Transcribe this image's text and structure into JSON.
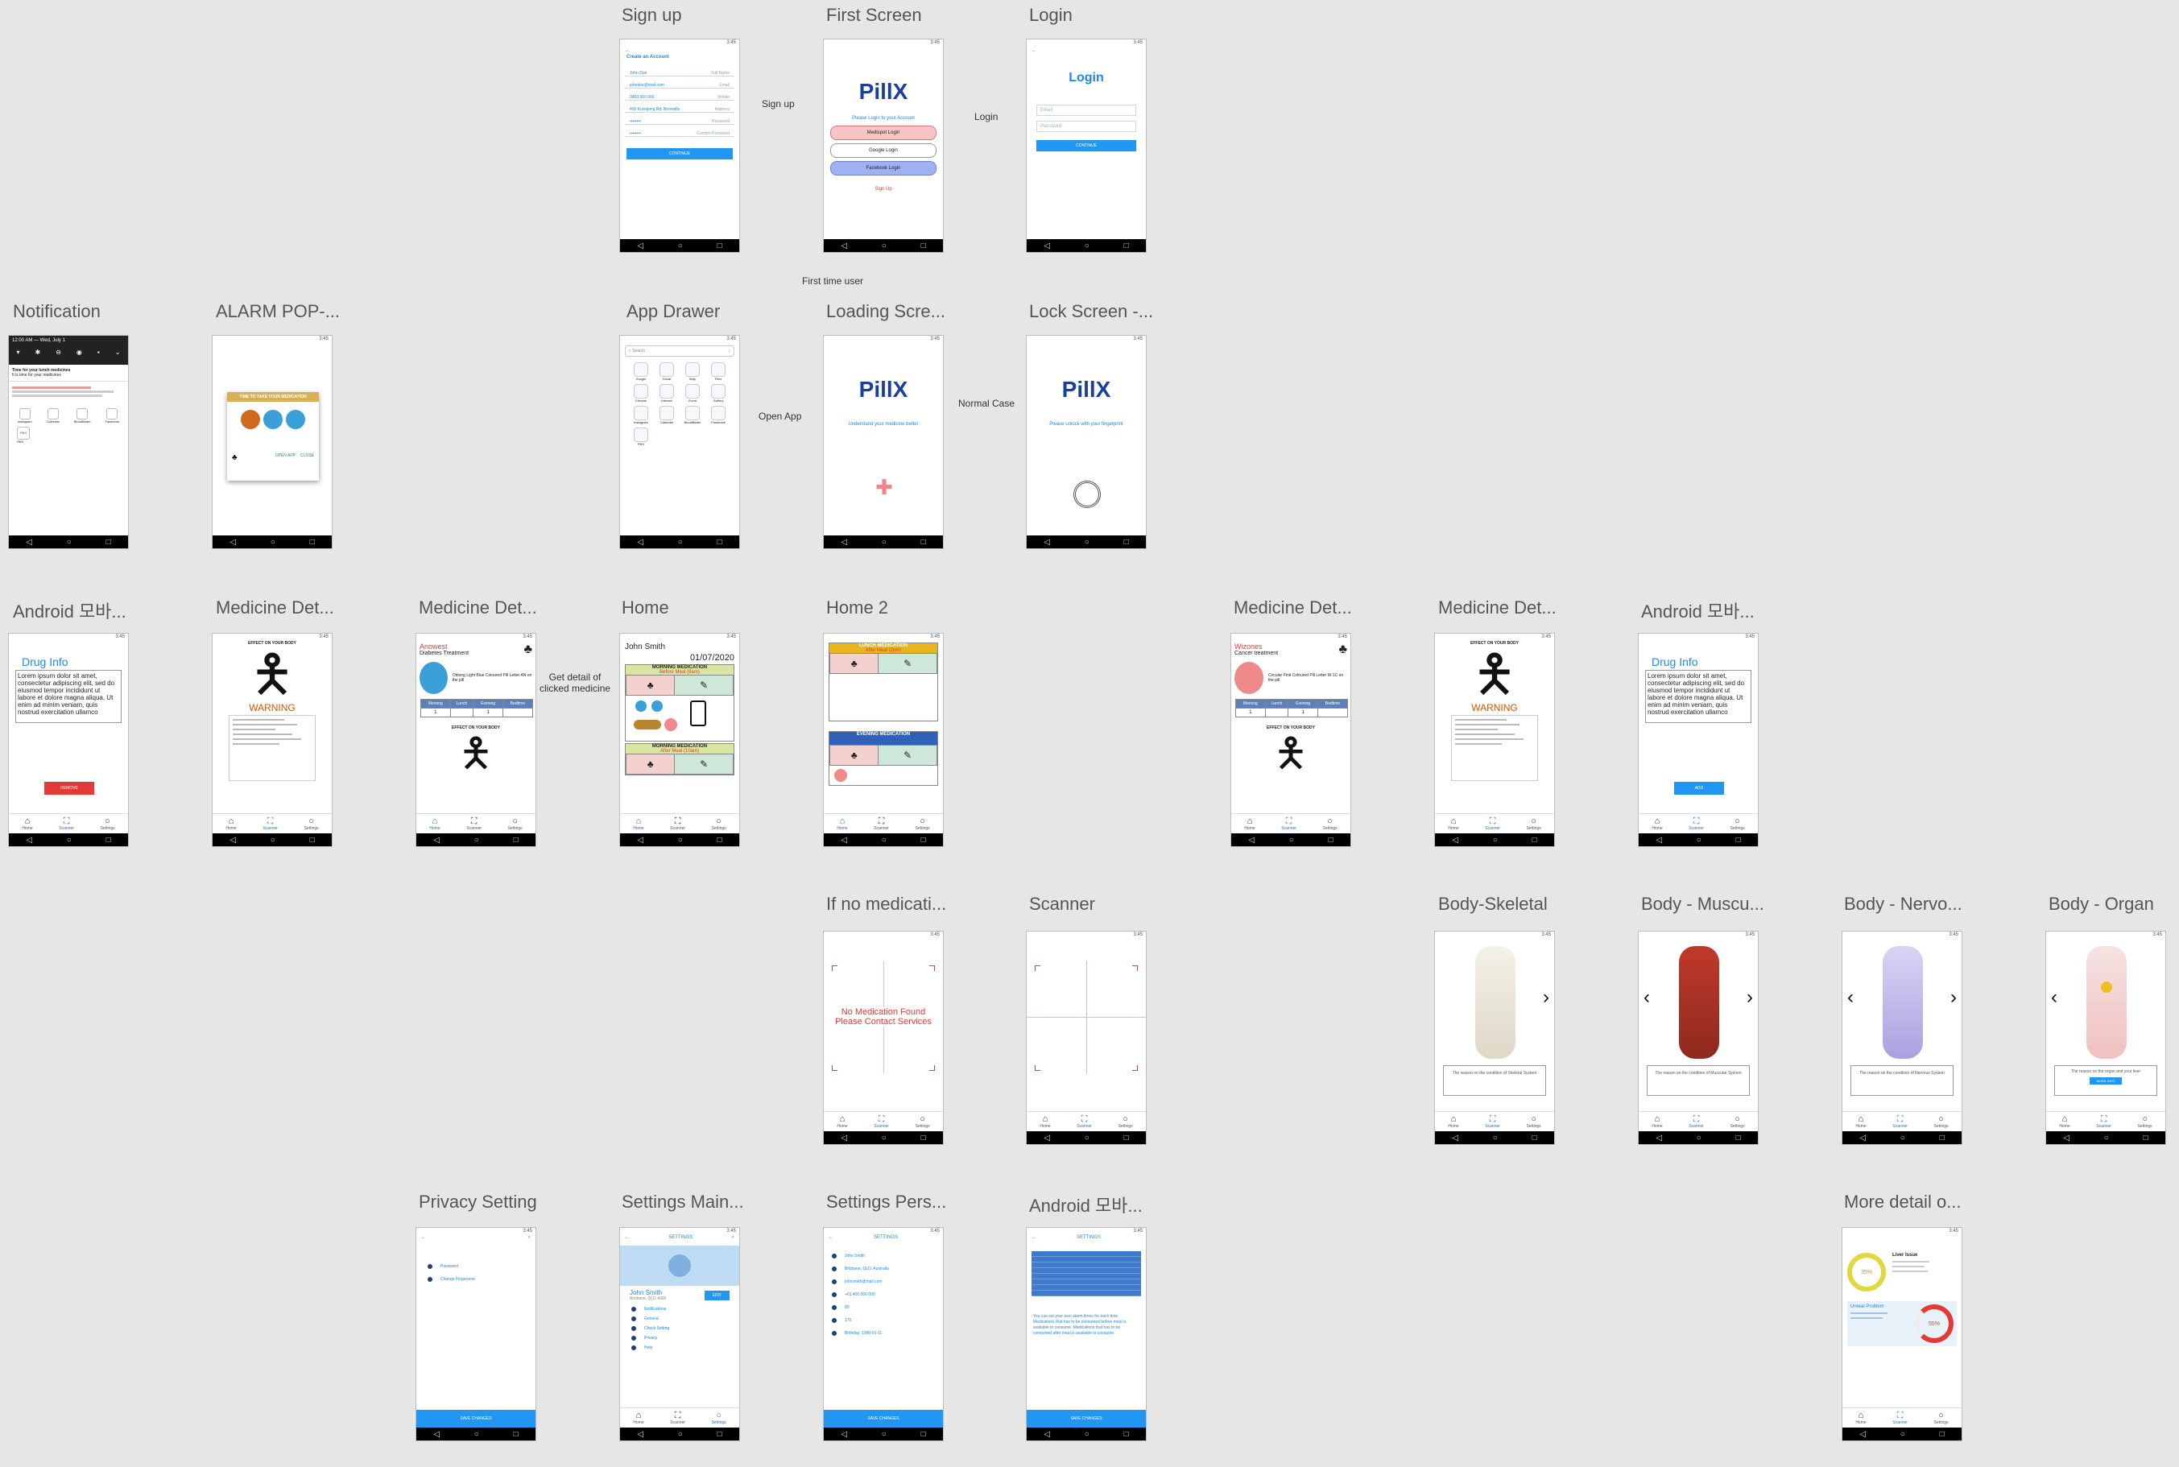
{
  "titles": {
    "signup": "Sign up",
    "first_screen": "First Screen",
    "login": "Login",
    "notification": "Notification",
    "alarm": "ALARM POP-...",
    "app_drawer": "App Drawer",
    "loading": "Loading Scre...",
    "lock": "Lock Screen -...",
    "android1": "Android 모바...",
    "medicine_det1": "Medicine Det...",
    "medicine_det2": "Medicine Det...",
    "home": "Home",
    "home2": "Home 2",
    "medicine_det3": "Medicine Det...",
    "medicine_det4": "Medicine Det...",
    "android2": "Android 모바...",
    "no_med": "If no medicati...",
    "scanner": "Scanner",
    "body_skeletal": "Body-Skeletal",
    "body_muscu": "Body - Muscu...",
    "body_nervo": "Body - Nervo...",
    "body_organ": "Body - Organ",
    "privacy": "Privacy Setting",
    "settings_main": "Settings Main...",
    "settings_pers": "Settings Pers...",
    "android3": "Android 모바...",
    "more_detail": "More detail o..."
  },
  "flow": {
    "sign_up": "Sign up",
    "login": "Login",
    "first_time_user": "First time user",
    "open_app": "Open App",
    "normal_case": "Normal Case",
    "get_detail_1": "Get detail of",
    "get_detail_2": "clicked medicine"
  },
  "status_time": "3:45",
  "brand": "PillX",
  "signup": {
    "heading": "Create an Account",
    "fields": [
      {
        "value": "John Doe",
        "hint": "Full Name"
      },
      {
        "value": "johndoe@mail.com",
        "hint": "Email"
      },
      {
        "value": "0400 000 000",
        "hint": "Mobile"
      },
      {
        "value": "400 Kurrajong Rd, Boonville",
        "hint": "Address"
      },
      {
        "value": "••••••••",
        "hint": "Password"
      },
      {
        "value": "••••••••",
        "hint": "Confirm Password"
      }
    ],
    "button": "CONTINUE"
  },
  "first_screen": {
    "prompt": "Please Login to your Account",
    "btn1": "Medispot Login",
    "btn2": "Google Login",
    "btn3": "Facebook Login",
    "signup": "Sign Up"
  },
  "login": {
    "heading": "Login",
    "user_ph": "Email",
    "pass_ph": "Password",
    "button": "CONTINUE"
  },
  "notification": {
    "time": "12:00 AM — Wed, July 1",
    "line1": "Time for your lunch medicines",
    "line2": "It is time for your medicines",
    "apps": [
      "Instagram",
      "Calendar",
      "BloodBeam",
      "Facebook"
    ],
    "pillx": "PillX"
  },
  "alarm": {
    "banner": "TIME TO TAKE YOUR MEDICATION",
    "open": "OPEN APP",
    "close": "CLOSE"
  },
  "drawer": {
    "search": "Search",
    "apps": [
      "Google",
      "Gmail",
      "Map",
      "Files",
      "Chrome",
      "Internet",
      "Zoom",
      "Gallery",
      "Instagram",
      "Calendar",
      "BloodBeam",
      "Facebook",
      "PillX"
    ]
  },
  "loading": {
    "tagline": "Understand your medicine better"
  },
  "lock": {
    "tagline": "Please unlock with your fingerprint"
  },
  "drug_info": {
    "title": "Drug Info",
    "text": "Lorem ipsum dolor sit amet, consectetur adipiscing elit, sed do eiusmod tempor incididunt ut labore et dolore magna aliqua. Ut enim ad minim veniam, quis nostrud exercitation ullamco",
    "btn_red": "REMOVE",
    "btn_blue": "ADD"
  },
  "nav": {
    "home": "Home",
    "scanner": "Scanner",
    "settings": "Settings"
  },
  "effect": {
    "title": "EFFECT ON YOUR BODY",
    "warning": "WARNING"
  },
  "anowest": {
    "name": "Anowest",
    "sub": "Diabetes Treatment",
    "desc": "Oblong Light Blue Coloured Pill Letter AN on the pill",
    "cols": [
      "Morning",
      "Lunch",
      "Evening",
      "Bedtime"
    ],
    "vals": [
      "1",
      "",
      "1",
      ""
    ]
  },
  "wizones": {
    "name": "Wizones",
    "sub": "Cancer treatment",
    "desc": "Circular Pink Coloured Pill Letter W-1C on the pill",
    "cols": [
      "Morning",
      "Lunch",
      "Evening",
      "Bedtime"
    ],
    "vals": [
      "1",
      "",
      "1",
      ""
    ]
  },
  "home": {
    "user": "John Smith",
    "date": "01/07/2020",
    "morning": "MORNING MEDICATION",
    "before": "Before Meal (8am)",
    "after": "After Meal (10am)"
  },
  "home2": {
    "lunch": "LUNCH MEDICATION",
    "lunch_sub": "After Meal (2pm)",
    "evening": "EVENING MEDICATION"
  },
  "no_med": {
    "line1": "No Medication Found",
    "line2": "Please Contact Services"
  },
  "body": {
    "skeletal": "The reason on the condition of Skeletal System",
    "muscular": "The reason on the condition of Muscular System",
    "nervous": "The reason on the condition of Nervous System",
    "organ": "The reason on the organ and your liver",
    "organ_btn": "MORE INFO"
  },
  "settings": {
    "header": "SETTINGS",
    "save": "SAVE CHANGES",
    "privacy_items": [
      "Password",
      "Change Fingerprint"
    ],
    "profile_name": "John Smith",
    "profile_loc": "Brisbane, QLD 4000",
    "edit": "EDIT",
    "menu": [
      "Notifications",
      "General",
      "Check Setting",
      "Privacy",
      "Help"
    ],
    "pers": [
      "John Smith",
      "Brisbane, QLD, Australia",
      "johnsmith@mail.com",
      "+61 400 000 000",
      "80",
      "170",
      "Birthday: 1990-01-11"
    ],
    "android_text": "You can set your own alarm times for each time. Medications that has to be consumed before meal is available to consume. Medications that has to be consumed after meal is available to consume."
  },
  "more_detail": {
    "t1": "Liver Issue",
    "p1": "35%",
    "t2": "Unreal Problem",
    "p2": "55%"
  }
}
